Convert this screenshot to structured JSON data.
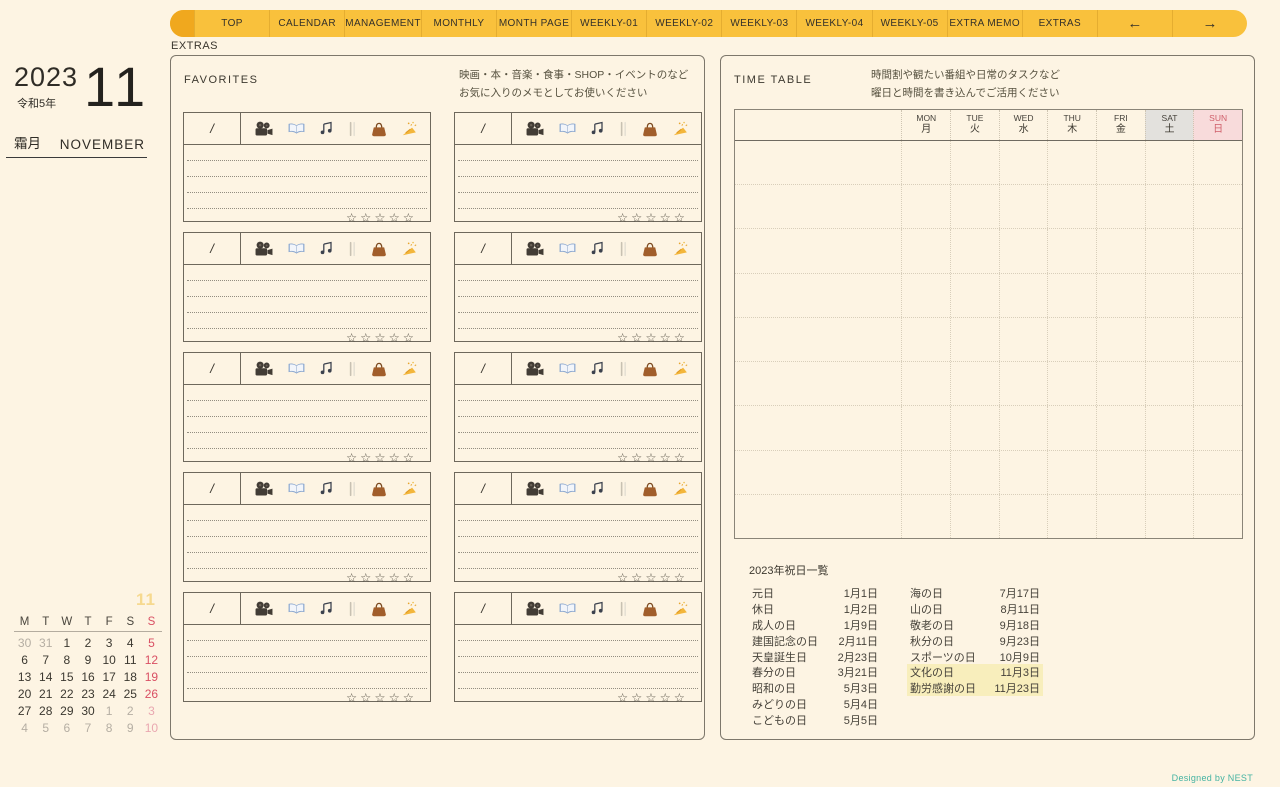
{
  "nav": {
    "items": [
      "TOP",
      "CALENDAR",
      "MANAGEMENT",
      "MONTHLY",
      "MONTH PAGE",
      "WEEKLY-01",
      "WEEKLY-02",
      "WEEKLY-03",
      "WEEKLY-04",
      "WEEKLY-05",
      "EXTRA MEMO",
      "EXTRAS"
    ],
    "prev_arrow": "←",
    "next_arrow": "→",
    "active_page_label": "EXTRAS"
  },
  "date_panel": {
    "year": "2023",
    "era": "令和5年",
    "month_number": "11",
    "month_jp": "霜月",
    "month_en": "NOVEMBER",
    "watermark": "11"
  },
  "mini_calendar": {
    "day_headers": [
      [
        "M",
        "wk"
      ],
      [
        "T",
        "wk"
      ],
      [
        "W",
        "wk"
      ],
      [
        "T",
        "wk"
      ],
      [
        "F",
        "wk"
      ],
      [
        "S",
        "wk"
      ],
      [
        "S",
        "sun"
      ]
    ],
    "weeks": [
      [
        [
          "30",
          "muted"
        ],
        [
          "31",
          "muted"
        ],
        [
          "1",
          "normal"
        ],
        [
          "2",
          "normal"
        ],
        [
          "3",
          "normal"
        ],
        [
          "4",
          "normal"
        ],
        [
          "5",
          "sun"
        ]
      ],
      [
        [
          "6",
          "normal"
        ],
        [
          "7",
          "normal"
        ],
        [
          "8",
          "normal"
        ],
        [
          "9",
          "normal"
        ],
        [
          "10",
          "normal"
        ],
        [
          "11",
          "normal"
        ],
        [
          "12",
          "sun"
        ]
      ],
      [
        [
          "13",
          "normal"
        ],
        [
          "14",
          "normal"
        ],
        [
          "15",
          "normal"
        ],
        [
          "16",
          "normal"
        ],
        [
          "17",
          "normal"
        ],
        [
          "18",
          "normal"
        ],
        [
          "19",
          "sun"
        ]
      ],
      [
        [
          "20",
          "normal"
        ],
        [
          "21",
          "normal"
        ],
        [
          "22",
          "normal"
        ],
        [
          "23",
          "normal"
        ],
        [
          "24",
          "normal"
        ],
        [
          "25",
          "normal"
        ],
        [
          "26",
          "sun"
        ]
      ],
      [
        [
          "27",
          "normal"
        ],
        [
          "28",
          "normal"
        ],
        [
          "29",
          "normal"
        ],
        [
          "30",
          "normal"
        ],
        [
          "1",
          "muted"
        ],
        [
          "2",
          "muted"
        ],
        [
          "3",
          "sun-muted"
        ]
      ],
      [
        [
          "4",
          "muted"
        ],
        [
          "5",
          "muted"
        ],
        [
          "6",
          "muted"
        ],
        [
          "7",
          "muted"
        ],
        [
          "8",
          "muted"
        ],
        [
          "9",
          "muted"
        ],
        [
          "10",
          "sun-muted"
        ]
      ]
    ]
  },
  "favorites": {
    "title": "FAVORITES",
    "description_lines": [
      "映画・本・音楽・食事・SHOP・イベントのなど",
      "お気に入りのメモとしてお使いください"
    ],
    "card_count": 10,
    "card": {
      "date_label": "/",
      "icons": [
        "movie-camera",
        "open-book",
        "musical-notes",
        "chopsticks",
        "handbag",
        "party-popper"
      ],
      "stars": "☆☆☆☆☆",
      "note_lines": 4
    }
  },
  "timetable": {
    "title": "TIME TABLE",
    "description_lines": [
      "時間割や観たい番組や日常のタスクなど",
      "曜日と時間を書き込んでご活用ください"
    ],
    "columns": [
      {
        "en": "MON",
        "jp": "月",
        "style": "wk"
      },
      {
        "en": "TUE",
        "jp": "火",
        "style": "wk"
      },
      {
        "en": "WED",
        "jp": "水",
        "style": "wk"
      },
      {
        "en": "THU",
        "jp": "木",
        "style": "wk"
      },
      {
        "en": "FRI",
        "jp": "金",
        "style": "wk"
      },
      {
        "en": "SAT",
        "jp": "土",
        "style": "sat"
      },
      {
        "en": "SUN",
        "jp": "日",
        "style": "sun"
      }
    ],
    "body_rows": 9
  },
  "holidays": {
    "title": "2023年祝日一覧",
    "left": [
      {
        "name": "元日",
        "date": "1月1日"
      },
      {
        "name": "休日",
        "date": "1月2日"
      },
      {
        "name": "成人の日",
        "date": "1月9日"
      },
      {
        "name": "建国記念の日",
        "date": "2月11日"
      },
      {
        "name": "天皇誕生日",
        "date": "2月23日"
      },
      {
        "name": "春分の日",
        "date": "3月21日"
      },
      {
        "name": "昭和の日",
        "date": "5月3日"
      },
      {
        "name": "みどりの日",
        "date": "5月4日"
      },
      {
        "name": "こどもの日",
        "date": "5月5日"
      }
    ],
    "right": [
      {
        "name": "海の日",
        "date": "7月17日"
      },
      {
        "name": "山の日",
        "date": "8月11日"
      },
      {
        "name": "敬老の日",
        "date": "9月18日"
      },
      {
        "name": "秋分の日",
        "date": "9月23日"
      },
      {
        "name": "スポーツの日",
        "date": "10月9日"
      },
      {
        "name": "文化の日",
        "date": "11月3日",
        "highlight": true
      },
      {
        "name": "勤労感謝の日",
        "date": "11月23日",
        "highlight": true
      }
    ]
  },
  "footer": {
    "credit": "Designed by NEST"
  },
  "colors": {
    "background": "#fdf4e3",
    "nav_yellow": "#f9c13c",
    "nav_cap": "#f0a81e",
    "sat_header_bg": "#e3e1dd",
    "sun_header_bg": "#f8dbdb",
    "sun_text": "#cf5f6a",
    "holiday_highlight": "#f8eebc",
    "credit_teal": "#45b3a2"
  }
}
